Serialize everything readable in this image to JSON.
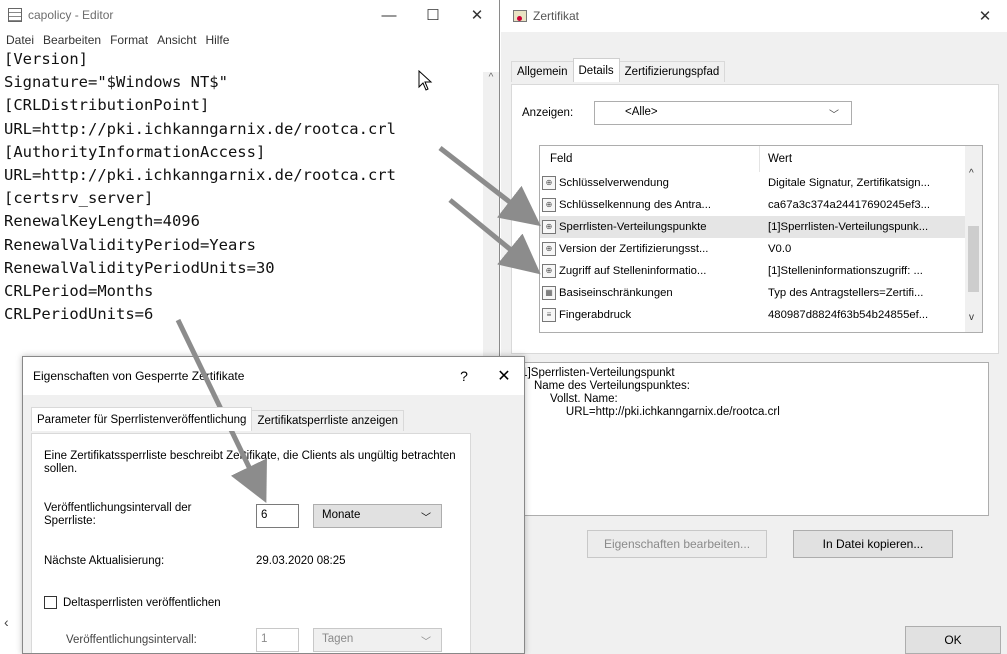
{
  "notepad": {
    "title": "capolicy - Editor",
    "menu": [
      "Datei",
      "Bearbeiten",
      "Format",
      "Ansicht",
      "Hilfe"
    ],
    "content": "[Version]\nSignature=\"$Windows NT$\"\n[CRLDistributionPoint]\nURL=http://pki.ichkanngarnix.de/rootca.crl\n[AuthorityInformationAccess]\nURL=http://pki.ichkanngarnix.de/rootca.crt\n[certsrv_server]\nRenewalKeyLength=4096\nRenewalValidityPeriod=Years\nRenewalValidityPeriodUnits=30\nCRLPeriod=Months\nCRLPeriodUnits=6"
  },
  "cert": {
    "title": "Zertifikat",
    "tabs": [
      "Allgemein",
      "Details",
      "Zertifizierungspfad"
    ],
    "show_label": "Anzeigen:",
    "show_value": "<Alle>",
    "col_field": "Feld",
    "col_value": "Wert",
    "rows": [
      {
        "field": "Schlüsselverwendung",
        "value": "Digitale Signatur, Zertifikatsign..."
      },
      {
        "field": "Schlüsselkennung des Antra...",
        "value": "ca67a3c374a24417690245ef3..."
      },
      {
        "field": "Sperrlisten-Verteilungspunkte",
        "value": "[1]Sperrlisten-Verteilungspunk..."
      },
      {
        "field": "Version der Zertifizierungsst...",
        "value": "V0.0"
      },
      {
        "field": "Zugriff auf Stelleninformatio...",
        "value": "[1]Stelleninformationszugriff: ..."
      },
      {
        "field": "Basiseinschränkungen",
        "value": "Typ des Antragstellers=Zertifi..."
      },
      {
        "field": "Fingerabdruck",
        "value": "480987d8824f63b54b24855ef..."
      }
    ],
    "detail_text": "[1]Sperrlisten-Verteilungspunkt\n     Name des Verteilungspunktes:\n          Vollst. Name:\n               URL=http://pki.ichkanngarnix.de/rootca.crl",
    "btn_edit": "Eigenschaften bearbeiten...",
    "btn_copy": "In Datei kopieren...",
    "btn_ok": "OK"
  },
  "crl": {
    "title": "Eigenschaften von Gesperrte Zertifikate",
    "help": "?",
    "close": "✕",
    "tabs": [
      "Parameter für Sperrlistenveröffentlichung",
      "Zertifikatsperrliste anzeigen"
    ],
    "description": "Eine Zertifikatssperrliste beschreibt Zertifikate, die Clients als ungültig betrachten sollen.",
    "interval_label": "Veröffentlichungsintervall der Sperrliste:",
    "interval_value": "6",
    "interval_unit": "Monate",
    "next_label": "Nächste Aktualisierung:",
    "next_value": "29.03.2020 08:25",
    "delta_label": "Deltasperrlisten veröffentlichen",
    "delta_interval_label": "Veröffentlichungsintervall:",
    "delta_interval_value": "1",
    "delta_interval_unit": "Tagen"
  }
}
